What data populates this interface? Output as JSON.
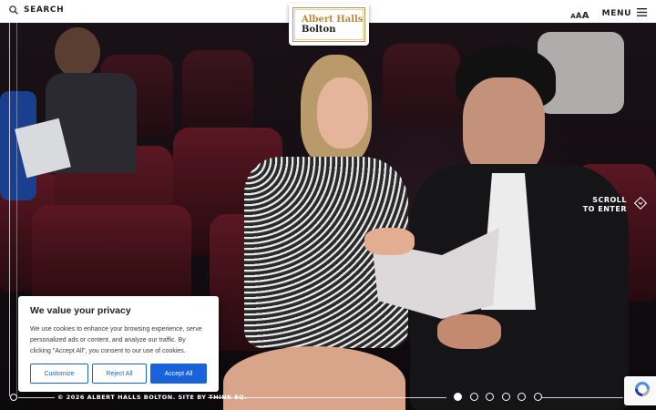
{
  "header": {
    "search_label": "SEARCH",
    "text_size_label": {
      "small": "A",
      "medium": "A",
      "large": "A"
    },
    "menu_label": "MENU"
  },
  "logo": {
    "line1": "Albert Halls",
    "line2": "Bolton"
  },
  "hero": {
    "scroll_line1": "SCROLL",
    "scroll_line2": "TO ENTER"
  },
  "cookie_banner": {
    "title": "We value your privacy",
    "body": "We use cookies to enhance your browsing experience, serve personalized ads or content, and analyze our traffic. By clicking \"Accept All\", you consent to our use of cookies.",
    "customize_label": "Customize",
    "reject_label": "Reject All",
    "accept_label": "Accept All"
  },
  "footer": {
    "copyright": "© 2026 ALBERT HALLS BOLTON. SITE BY THINK EQ."
  },
  "slider": {
    "slide_count": 6,
    "active_index": 0
  },
  "colors": {
    "accent_blue": "#1863dc",
    "logo_gold": "#b8893a",
    "seat_red": "#5a1722"
  },
  "icons": [
    "search-icon",
    "hamburger-menu-icon",
    "diamond-arrow-icon",
    "recaptcha-icon"
  ]
}
